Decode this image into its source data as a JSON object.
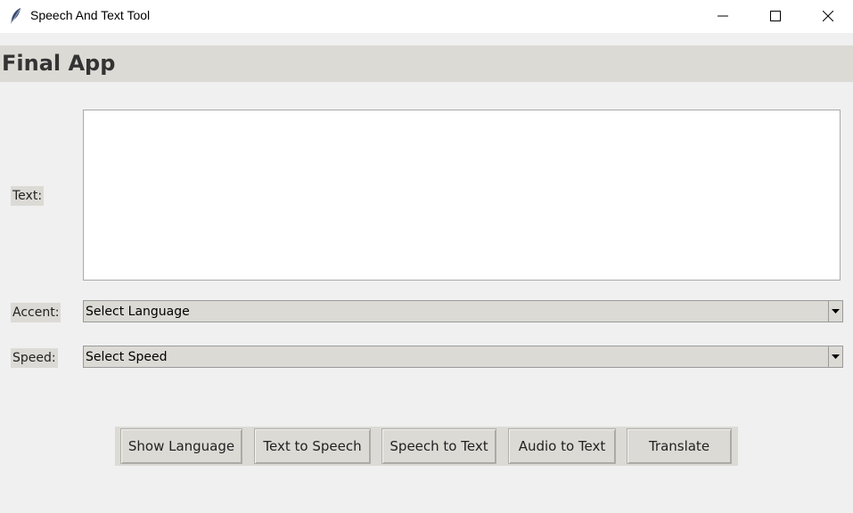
{
  "window": {
    "title": "Speech And Text Tool",
    "controls": [
      "minimize-icon",
      "maximize-icon",
      "close-icon"
    ]
  },
  "header": {
    "title": "Final App"
  },
  "form": {
    "text_label": "Text:",
    "text_value": "",
    "accent_label": "Accent:",
    "accent_value": "Select Language",
    "speed_label": "Speed:",
    "speed_value": "Select Speed"
  },
  "buttons": {
    "show_language": "Show Language",
    "text_to_speech": "Text to Speech",
    "speech_to_text": "Speech to Text",
    "audio_to_text": "Audio to Text",
    "translate": "Translate"
  },
  "colors": {
    "window_bg": "#f0f0f0",
    "widget_bg": "#dcdad5",
    "titlebar_bg": "#ffffff"
  }
}
